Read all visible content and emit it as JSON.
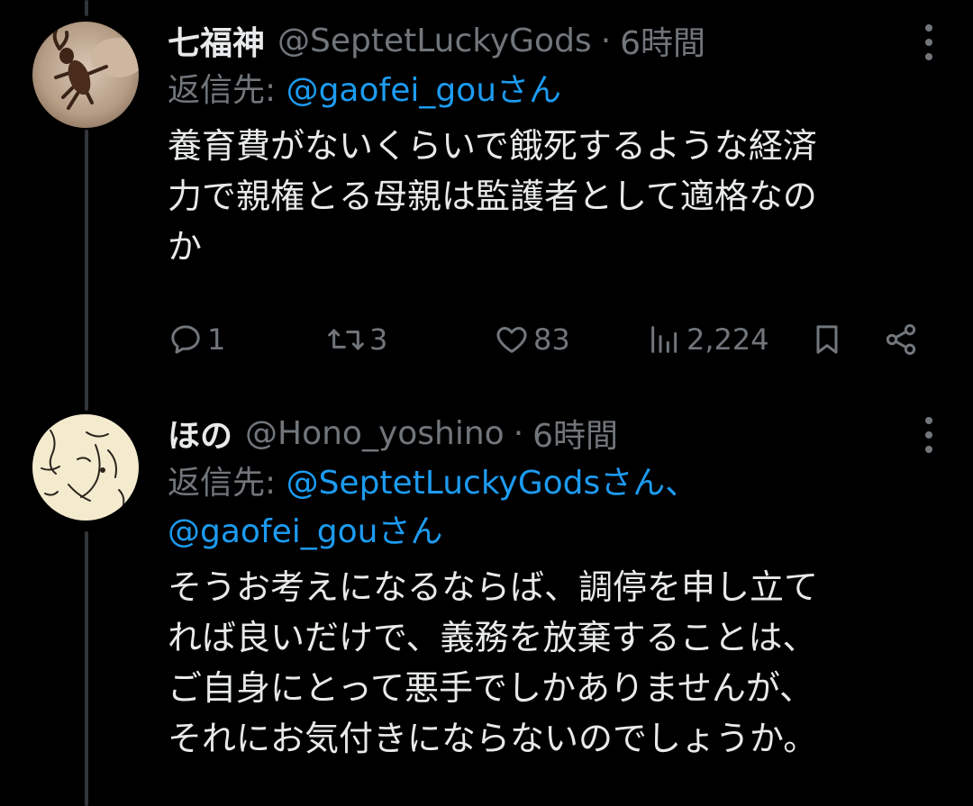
{
  "tweets": [
    {
      "display_name": "七福神",
      "handle": "@SeptetLuckyGods",
      "separator": "·",
      "time": "6時間",
      "reply_to_label": "返信先: ",
      "reply_to_line1": "@gaofei_gouさん",
      "body_lines": [
        "養育費がないくらいで餓死するような経済",
        "力で親権とる母親は監護者として適格なの",
        "か"
      ],
      "actions": {
        "replies": "1",
        "retweets": "3",
        "likes": "83",
        "views": "2,224"
      },
      "avatar_icon": "stag-beetle-avatar"
    },
    {
      "display_name": "ほの",
      "handle": "@Hono_yoshino",
      "separator": "·",
      "time": "6時間",
      "reply_to_label": "返信先: ",
      "reply_to_line1": "@SeptetLuckyGodsさん、",
      "reply_to_line2": "@gaofei_gouさん",
      "body_lines": [
        "そうお考えになるならば、調停を申し立て",
        "れば良いだけで、義務を放棄することは、",
        "ご自身にとって悪手でしかありませんが、",
        "それにお気付きにならないのでしょうか。"
      ],
      "avatar_icon": "sketch-drawing-avatar"
    }
  ],
  "icons": {
    "reply": "reply-icon",
    "retweet": "retweet-icon",
    "like": "heart-icon",
    "views": "views-chart-icon",
    "bookmark": "bookmark-icon",
    "share": "share-icon",
    "more": "more-dots-icon"
  },
  "colors": {
    "background": "#000000",
    "text_primary": "#e7e9ea",
    "text_secondary": "#71767b",
    "mention": "#1d9bf0",
    "thread_line": "#333639"
  }
}
